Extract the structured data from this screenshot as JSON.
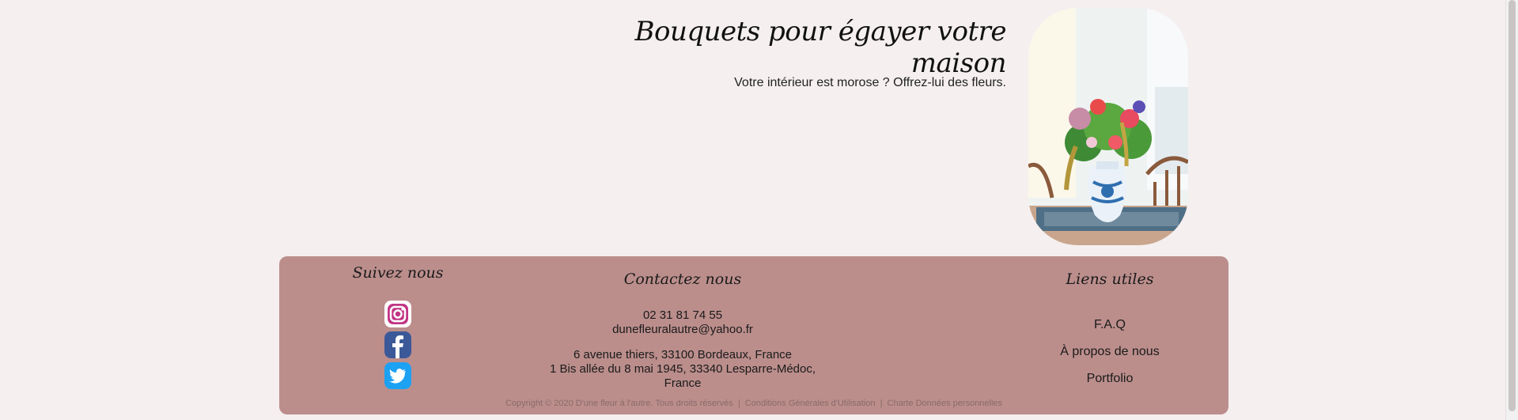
{
  "hero": {
    "title": "Bouquets pour égayer votre maison",
    "subtitle": "Votre intérieur est morose ? Offrez-lui des fleurs."
  },
  "footer": {
    "follow": {
      "title": "Suivez nous",
      "icons": [
        "instagram-icon",
        "facebook-icon",
        "twitter-icon"
      ]
    },
    "contact": {
      "title": "Contactez nous",
      "phone": "02 31 81 74 55",
      "email": "dunefleuralautre@yahoo.fr",
      "address_1": "6 avenue thiers, 33100 Bordeaux, France",
      "address_2": "1 Bis allée du 8 mai 1945, 33340 Lesparre-Médoc, France"
    },
    "links": {
      "title": "Liens utiles",
      "items": [
        "F.A.Q",
        "À propos de nous",
        "Portfolio"
      ]
    },
    "copyright": {
      "notice": "Copyright © 2020 D'une fleur à l'autre. Tous droits réservés",
      "separator": "|",
      "cgu": "Conditions Générales d'Utilisation",
      "charte": "Charte Données personnelles"
    }
  },
  "colors": {
    "page_background": "#f5efef",
    "footer_background": "#bb8e8c",
    "instagram": "#c13584",
    "facebook": "#3b5998",
    "twitter": "#1da1f2"
  }
}
